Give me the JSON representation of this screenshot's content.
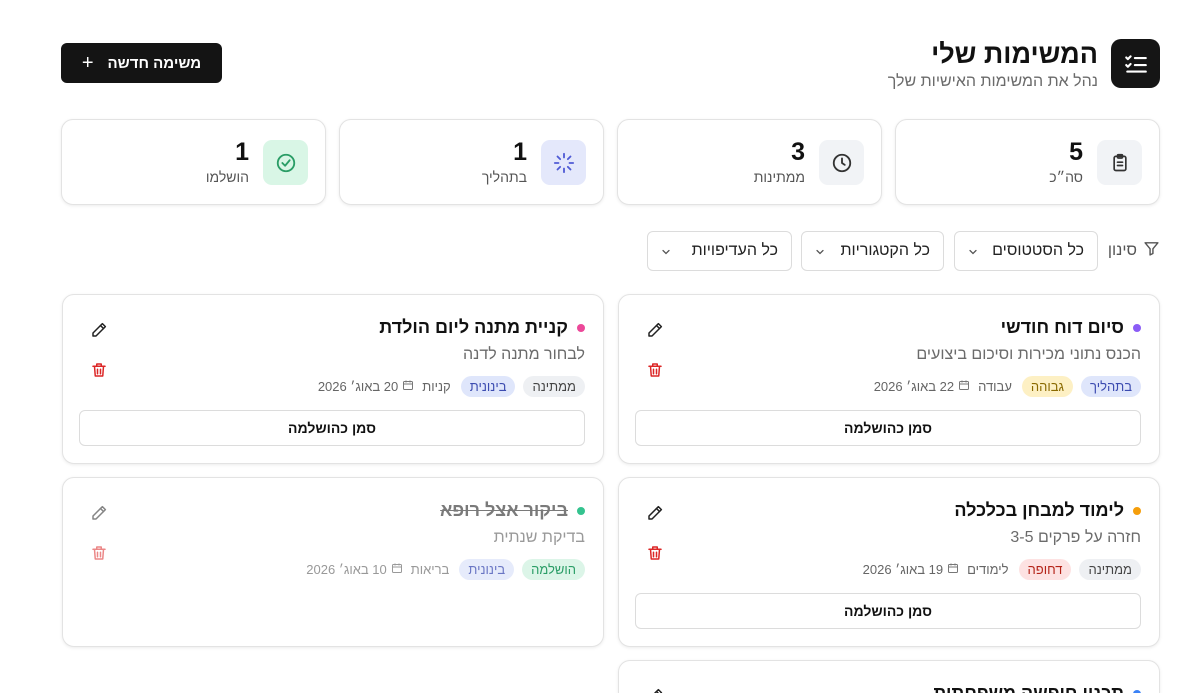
{
  "header": {
    "title": "המשימות שלי",
    "subtitle": "נהל את המשימות האישיות שלך",
    "new_task_label": "משימה חדשה"
  },
  "stats": [
    {
      "label": "סה״כ",
      "value": "5",
      "icon": "clipboard-icon",
      "icon_bg": "#f1f3f6",
      "icon_color": "#333333"
    },
    {
      "label": "ממתינות",
      "value": "3",
      "icon": "clock-icon",
      "icon_bg": "#f1f3f6",
      "icon_color": "#333333"
    },
    {
      "label": "בתהליך",
      "value": "1",
      "icon": "loader-icon",
      "icon_bg": "#e4e8fb",
      "icon_color": "#4f5bd5"
    },
    {
      "label": "הושלמו",
      "value": "1",
      "icon": "check-circle-icon",
      "icon_bg": "#d9f6e6",
      "icon_color": "#2a9d66"
    }
  ],
  "filters": {
    "label": "סינון",
    "status": "כל הסטטוסים",
    "category": "כל הקטגוריות",
    "priority": "כל העדיפויות"
  },
  "tasks": [
    {
      "title": "סיום דוח חודשי",
      "description": "הכנס נתוני מכירות וסיכום ביצועים",
      "dot_color": "#8b5cf6",
      "status": "בתהליך",
      "status_bg": "#dfe6fb",
      "status_color": "#3b4bb0",
      "priority": "גבוהה",
      "priority_bg": "#fdf0c4",
      "priority_color": "#8a6a00",
      "category": "עבודה",
      "date": "22 באוג׳ 2026",
      "complete_label": "סמן כהושלמה",
      "done": false
    },
    {
      "title": "קניית מתנה ליום הולדת",
      "description": "לבחור מתנה לדנה",
      "dot_color": "#ec4899",
      "status": "ממתינה",
      "status_bg": "#eef0f3",
      "status_color": "#444444",
      "priority": "בינונית",
      "priority_bg": "#dfe6fb",
      "priority_color": "#3b4bb0",
      "category": "קניות",
      "date": "20 באוג׳ 2026",
      "complete_label": "סמן כהושלמה",
      "done": false
    },
    {
      "title": "לימוד למבחן בכלכלה",
      "description": "חזרה על פרקים 3-5",
      "dot_color": "#f59e0b",
      "status": "ממתינה",
      "status_bg": "#eef0f3",
      "status_color": "#444444",
      "priority": "דחופה",
      "priority_bg": "#fde2e2",
      "priority_color": "#b42318",
      "category": "לימודים",
      "date": "19 באוג׳ 2026",
      "complete_label": "סמן כהושלמה",
      "done": false
    },
    {
      "title": "ביקור אצל רופא",
      "description": "בדיקת שנתית",
      "dot_color": "#34c38f",
      "status": "הושלמה",
      "status_bg": "#dcf5e8",
      "status_color": "#2a9d66",
      "priority": "בינונית",
      "priority_bg": "#dfe6fb",
      "priority_color": "#3b4bb0",
      "category": "בריאות",
      "date": "10 באוג׳ 2026",
      "complete_label": "",
      "done": true
    },
    {
      "title": "תכנון חופשה משפחתית",
      "description": "",
      "dot_color": "#3b82f6",
      "status": "",
      "status_bg": "#eef0f3",
      "status_color": "#444444",
      "priority": "",
      "priority_bg": "#eef0f3",
      "priority_color": "#444444",
      "category": "",
      "date": "",
      "complete_label": "",
      "done": false
    }
  ]
}
